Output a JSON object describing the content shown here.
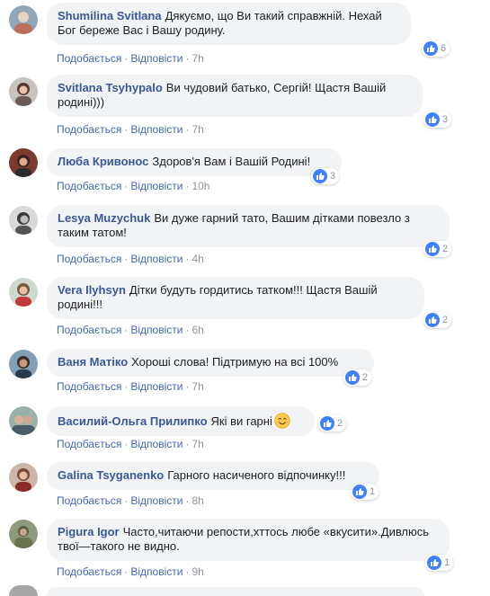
{
  "action_labels": {
    "like": "Подобається",
    "reply": "Відповісти"
  },
  "comments": [
    {
      "author": "Shumilina Svitlana",
      "text": "Дякуємо, що Ви такий справжній. Нехай Бог береже Вас і Вашу родину.",
      "time": "7h",
      "likes": "6"
    },
    {
      "author": "Svitlana Tsyhypalo",
      "text": "Ви чудовий батько, Сергій! Щастя Вашій родині)))",
      "time": "7h",
      "likes": "3"
    },
    {
      "author": "Люба Кривонос",
      "text": "Здоров'я Вам і Вашій Родині!",
      "time": "10h",
      "likes": "3"
    },
    {
      "author": "Lesya Muzychuk",
      "text": "Ви дуже гарний тато, Вашим дітками повезло з таким татом!",
      "time": "4h",
      "likes": "2"
    },
    {
      "author": "Vera Ilyhsyn",
      "text": "Дітки будуть гордитись татком!!! Щастя Вашій родині!!!",
      "time": "6h",
      "likes": "2"
    },
    {
      "author": "Ваня Матіко",
      "text": "Хороші слова! Підтримую на всі 100%",
      "time": "7h",
      "likes": "2"
    },
    {
      "author": "Василий-Ольга Прилипко",
      "text": "Які ви гарні",
      "time": "7h",
      "likes": "2",
      "emoji": "smiling-face-emoji"
    },
    {
      "author": "Galina Tsyganenko",
      "text": "Гарного насиченого відпочинку!!!",
      "time": "8h",
      "likes": "1"
    },
    {
      "author": "Pigura Igor",
      "text": "Часто,читаючи репости,хттось любе «вкусити».Дивлюсь твої—такого не видно.",
      "time": "9h",
      "likes": "1"
    }
  ],
  "colors": {
    "author": "#385898",
    "link": "#4267b2",
    "meta": "#90949c",
    "bubble": "#f2f3f5",
    "like": "#4080ff"
  }
}
